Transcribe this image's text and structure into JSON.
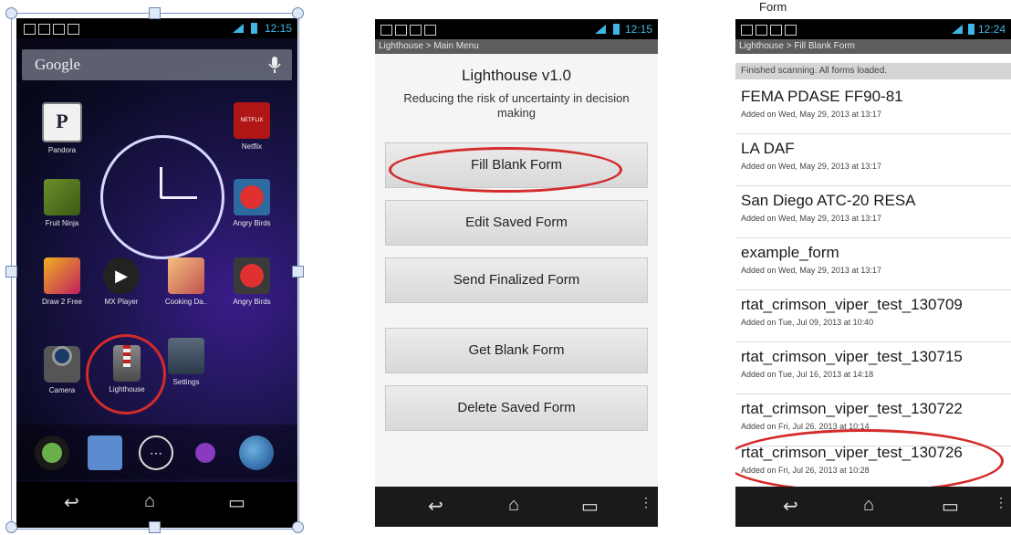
{
  "phone1": {
    "search_label": "Google",
    "apps": [
      {
        "label": "Pandora",
        "icon": "pandora-icon"
      },
      {
        "label": "Netflix",
        "icon": "netflix-icon"
      },
      {
        "label": "Fruit Ninja",
        "icon": "fruit-ninja-icon"
      },
      {
        "label": "Angry Birds",
        "icon": "angry-birds-icon"
      },
      {
        "label": "Draw 2 Free",
        "icon": "draw-icon"
      },
      {
        "label": "MX Player",
        "icon": "mx-player-icon"
      },
      {
        "label": "Cooking Da..",
        "icon": "cooking-icon"
      },
      {
        "label": "Angry Birds",
        "icon": "angry-birds-icon"
      },
      {
        "label": "Camera",
        "icon": "camera-icon"
      },
      {
        "label": "Lighthouse",
        "icon": "lighthouse-icon"
      },
      {
        "label": "Settings",
        "icon": "settings-icon"
      }
    ],
    "clock_time": "12:15",
    "accent": "#3fb6e8",
    "highlight": "#d42b2b"
  },
  "phone2": {
    "status_time": "12:15",
    "breadcrumb": "Lighthouse > Main Menu",
    "title": "Lighthouse v1.0",
    "subtitle": "Reducing the risk of uncertainty in decision making",
    "buttons": [
      {
        "label": "Fill Blank Form"
      },
      {
        "label": "Edit Saved Form"
      },
      {
        "label": "Send Finalized Form"
      },
      {
        "label": "Get Blank Form"
      },
      {
        "label": "Delete Saved Form"
      }
    ]
  },
  "phone3": {
    "caption": "Form",
    "status_time": "12:24",
    "breadcrumb": "Lighthouse > Fill Blank Form",
    "status_message": "Finished scanning. All forms loaded.",
    "forms": [
      {
        "name": "FEMA PDASE FF90-81",
        "added": "Added on Wed, May 29, 2013 at 13:17"
      },
      {
        "name": "LA DAF",
        "added": "Added on Wed, May 29, 2013 at 13:17"
      },
      {
        "name": "San Diego ATC-20 RESA",
        "added": "Added on Wed, May 29, 2013 at 13:17"
      },
      {
        "name": "example_form",
        "added": "Added on Wed, May 29, 2013 at 13:17"
      },
      {
        "name": "rtat_crimson_viper_test_130709",
        "added": "Added on Tue, Jul 09, 2013 at 10:40"
      },
      {
        "name": "rtat_crimson_viper_test_130715",
        "added": "Added on Tue, Jul 16, 2013 at 14:18"
      },
      {
        "name": "rtat_crimson_viper_test_130722",
        "added": "Added on Fri, Jul 26, 2013 at 10:14"
      },
      {
        "name": "rtat_crimson_viper_test_130726",
        "added": "Added on Fri, Jul 26, 2013 at 10:28"
      }
    ]
  }
}
